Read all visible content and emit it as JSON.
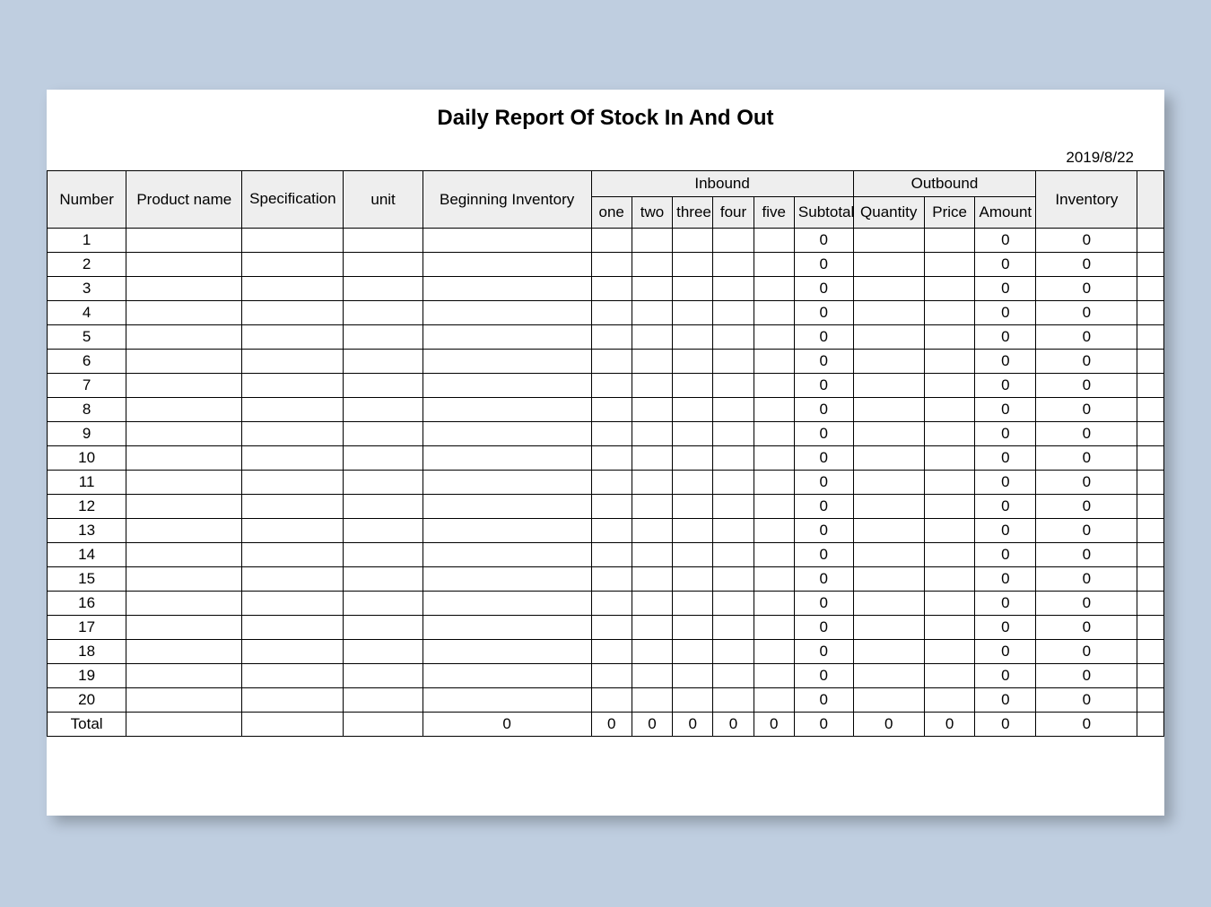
{
  "title": "Daily Report Of Stock In And Out",
  "date": "2019/8/22",
  "headers": {
    "number": "Number",
    "product": "Product name",
    "spec": "Specification",
    "unit": "unit",
    "beginning": "Beginning Inventory",
    "inbound": "Inbound",
    "outbound": "Outbound",
    "one": "one",
    "two": "two",
    "three": "three",
    "four": "four",
    "five": "five",
    "subtotal": "Subtotal",
    "quantity": "Quantity",
    "price": "Price",
    "amount": "Amount",
    "inventory": "Inventory"
  },
  "rows": [
    {
      "num": "1",
      "subtotal": "0",
      "amount": "0",
      "inventory": "0"
    },
    {
      "num": "2",
      "subtotal": "0",
      "amount": "0",
      "inventory": "0"
    },
    {
      "num": "3",
      "subtotal": "0",
      "amount": "0",
      "inventory": "0"
    },
    {
      "num": "4",
      "subtotal": "0",
      "amount": "0",
      "inventory": "0"
    },
    {
      "num": "5",
      "subtotal": "0",
      "amount": "0",
      "inventory": "0"
    },
    {
      "num": "6",
      "subtotal": "0",
      "amount": "0",
      "inventory": "0"
    },
    {
      "num": "7",
      "subtotal": "0",
      "amount": "0",
      "inventory": "0"
    },
    {
      "num": "8",
      "subtotal": "0",
      "amount": "0",
      "inventory": "0"
    },
    {
      "num": "9",
      "subtotal": "0",
      "amount": "0",
      "inventory": "0"
    },
    {
      "num": "10",
      "subtotal": "0",
      "amount": "0",
      "inventory": "0"
    },
    {
      "num": "11",
      "subtotal": "0",
      "amount": "0",
      "inventory": "0"
    },
    {
      "num": "12",
      "subtotal": "0",
      "amount": "0",
      "inventory": "0"
    },
    {
      "num": "13",
      "subtotal": "0",
      "amount": "0",
      "inventory": "0"
    },
    {
      "num": "14",
      "subtotal": "0",
      "amount": "0",
      "inventory": "0"
    },
    {
      "num": "15",
      "subtotal": "0",
      "amount": "0",
      "inventory": "0"
    },
    {
      "num": "16",
      "subtotal": "0",
      "amount": "0",
      "inventory": "0"
    },
    {
      "num": "17",
      "subtotal": "0",
      "amount": "0",
      "inventory": "0"
    },
    {
      "num": "18",
      "subtotal": "0",
      "amount": "0",
      "inventory": "0"
    },
    {
      "num": "19",
      "subtotal": "0",
      "amount": "0",
      "inventory": "0"
    },
    {
      "num": "20",
      "subtotal": "0",
      "amount": "0",
      "inventory": "0"
    }
  ],
  "total": {
    "label": "Total",
    "beginning": "0",
    "one": "0",
    "two": "0",
    "three": "0",
    "four": "0",
    "five": "0",
    "subtotal": "0",
    "quantity": "0",
    "price": "0",
    "amount": "0",
    "inventory": "0"
  }
}
